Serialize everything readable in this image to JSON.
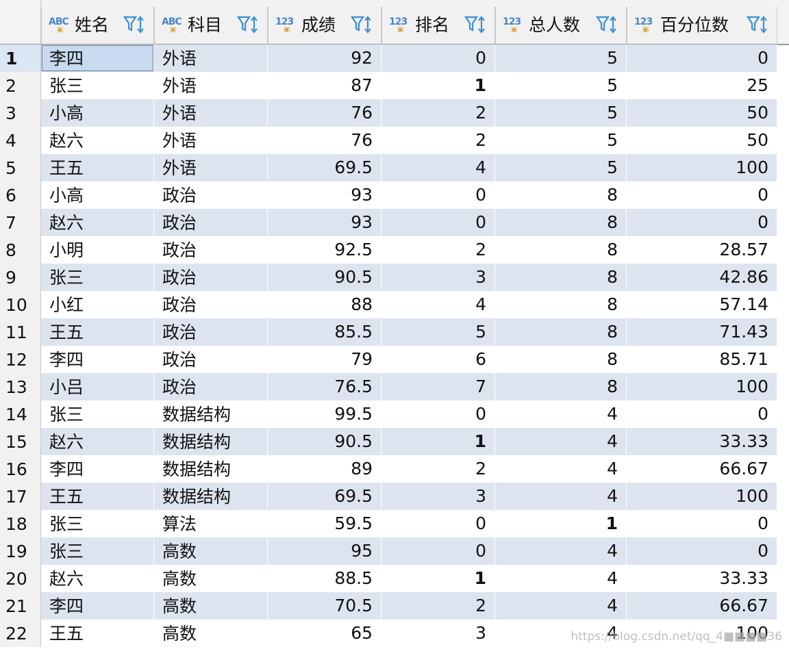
{
  "columns": [
    {
      "label": "姓名",
      "type_icon": "ABC",
      "align": "left"
    },
    {
      "label": "科目",
      "type_icon": "ABC",
      "align": "left"
    },
    {
      "label": "成绩",
      "type_icon": "123",
      "align": "right"
    },
    {
      "label": "排名",
      "type_icon": "123",
      "align": "right"
    },
    {
      "label": "总人数",
      "type_icon": "123",
      "align": "right"
    },
    {
      "label": "百分位数",
      "type_icon": "123",
      "align": "right"
    }
  ],
  "rows": [
    [
      "李四",
      "外语",
      "92",
      "0",
      "5",
      "0"
    ],
    [
      "张三",
      "外语",
      "87",
      "1",
      "5",
      "25"
    ],
    [
      "小高",
      "外语",
      "76",
      "2",
      "5",
      "50"
    ],
    [
      "赵六",
      "外语",
      "76",
      "2",
      "5",
      "50"
    ],
    [
      "王五",
      "外语",
      "69.5",
      "4",
      "5",
      "100"
    ],
    [
      "小高",
      "政治",
      "93",
      "0",
      "8",
      "0"
    ],
    [
      "赵六",
      "政治",
      "93",
      "0",
      "8",
      "0"
    ],
    [
      "小明",
      "政治",
      "92.5",
      "2",
      "8",
      "28.57"
    ],
    [
      "张三",
      "政治",
      "90.5",
      "3",
      "8",
      "42.86"
    ],
    [
      "小红",
      "政治",
      "88",
      "4",
      "8",
      "57.14"
    ],
    [
      "王五",
      "政治",
      "85.5",
      "5",
      "8",
      "71.43"
    ],
    [
      "李四",
      "政治",
      "79",
      "6",
      "8",
      "85.71"
    ],
    [
      "小吕",
      "政治",
      "76.5",
      "7",
      "8",
      "100"
    ],
    [
      "张三",
      "数据结构",
      "99.5",
      "0",
      "4",
      "0"
    ],
    [
      "赵六",
      "数据结构",
      "90.5",
      "1",
      "4",
      "33.33"
    ],
    [
      "李四",
      "数据结构",
      "89",
      "2",
      "4",
      "66.67"
    ],
    [
      "王五",
      "数据结构",
      "69.5",
      "3",
      "4",
      "100"
    ],
    [
      "张三",
      "算法",
      "59.5",
      "0",
      "1",
      "0"
    ],
    [
      "张三",
      "高数",
      "95",
      "0",
      "4",
      "0"
    ],
    [
      "赵六",
      "高数",
      "88.5",
      "1",
      "4",
      "33.33"
    ],
    [
      "李四",
      "高数",
      "70.5",
      "2",
      "4",
      "66.67"
    ],
    [
      "王五",
      "高数",
      "65",
      "3",
      "4",
      "100"
    ]
  ],
  "row_numbers": [
    "1",
    "2",
    "3",
    "4",
    "5",
    "6",
    "7",
    "8",
    "9",
    "10",
    "11",
    "12",
    "13",
    "14",
    "15",
    "16",
    "17",
    "18",
    "19",
    "20",
    "21",
    "22"
  ],
  "selected_row_index": 0,
  "watermark": "https://blog.csdn.net/qq_4■■■■36",
  "colors": {
    "row_stripe": "#dde4ef",
    "selection": "#c7daf0",
    "type_icon": "#4a86c8",
    "filter_icon": "#3a8fd6"
  }
}
